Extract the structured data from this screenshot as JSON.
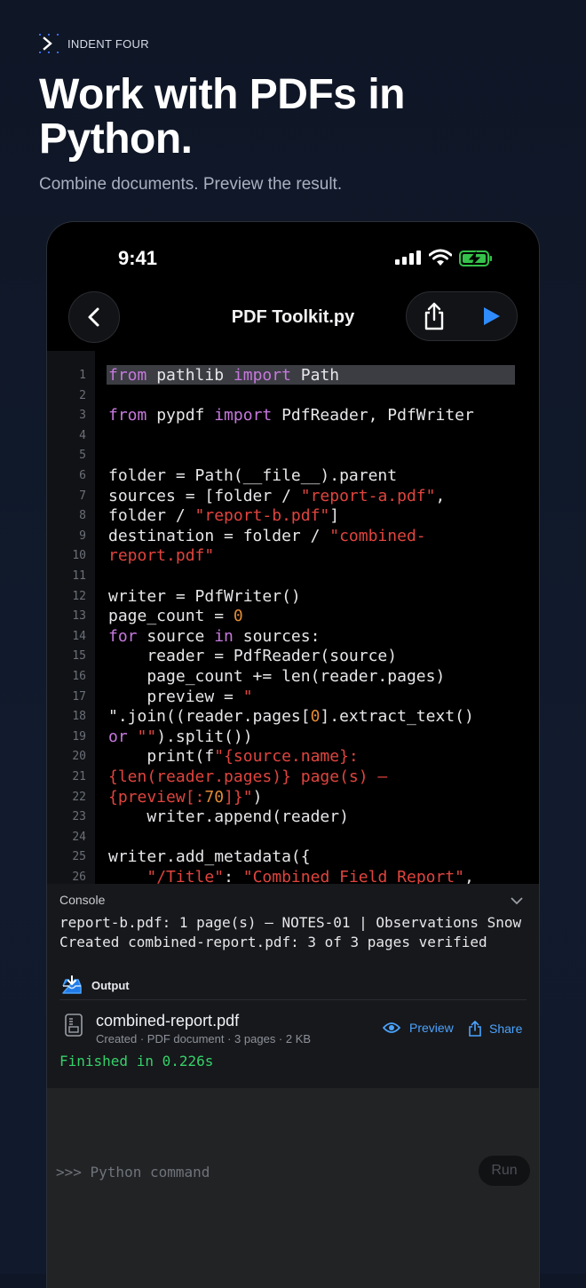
{
  "brand": {
    "name": "INDENT FOUR",
    "icon": "prompt-chevron-icon"
  },
  "headline": "Work with PDFs in Python.",
  "subhead": "Combine documents. Preview the result.",
  "status_bar": {
    "time": "9:41"
  },
  "toolbar": {
    "title": "PDF Toolkit.py"
  },
  "editor": {
    "line_numbers": [
      "1",
      "2",
      "3",
      "4",
      "5",
      "6",
      "7",
      "8",
      "9",
      "10",
      "11",
      "12",
      "13",
      "14",
      "15",
      "16",
      "17",
      "18",
      "19",
      "20",
      "21",
      "22",
      "23",
      "24",
      "25",
      "26"
    ],
    "lines": [
      [
        {
          "t": "from",
          "c": "kw"
        },
        {
          "t": " pathlib "
        },
        {
          "t": "import",
          "c": "kw"
        },
        {
          "t": " Path"
        }
      ],
      [],
      [
        {
          "t": "from",
          "c": "kw"
        },
        {
          "t": " pypdf "
        },
        {
          "t": "import",
          "c": "kw"
        },
        {
          "t": " PdfReader, PdfWriter"
        }
      ],
      [],
      [],
      [
        {
          "t": "folder = Path(__file__).parent"
        }
      ],
      [
        {
          "t": "sources = [folder / "
        },
        {
          "t": "\"report-a.pdf\"",
          "c": "st"
        },
        {
          "t": ","
        }
      ],
      [
        {
          "t": "folder / "
        },
        {
          "t": "\"report-b.pdf\"",
          "c": "st"
        },
        {
          "t": "]"
        }
      ],
      [
        {
          "t": "destination = folder / "
        },
        {
          "t": "\"combined-",
          "c": "st"
        }
      ],
      [
        {
          "t": "report.pdf\"",
          "c": "st"
        }
      ],
      [],
      [
        {
          "t": "writer = PdfWriter()"
        }
      ],
      [
        {
          "t": "page_count = "
        },
        {
          "t": "0",
          "c": "nm"
        }
      ],
      [
        {
          "t": "for",
          "c": "kw"
        },
        {
          "t": " source "
        },
        {
          "t": "in",
          "c": "kw"
        },
        {
          "t": " sources:"
        }
      ],
      [
        {
          "t": "    reader = PdfReader(source)"
        }
      ],
      [
        {
          "t": "    page_count += len(reader.pages)"
        }
      ],
      [
        {
          "t": "    preview = "
        },
        {
          "t": "\"",
          "c": "st"
        }
      ],
      [
        {
          "t": "\".join((reader.pages["
        },
        {
          "t": "0",
          "c": "nm"
        },
        {
          "t": "].extract_text()"
        }
      ],
      [
        {
          "t": "or",
          "c": "kw"
        },
        {
          "t": " "
        },
        {
          "t": "\"\"",
          "c": "st"
        },
        {
          "t": ").split())"
        }
      ],
      [
        {
          "t": "    print(f"
        },
        {
          "t": "\"{source.name}:",
          "c": "st"
        }
      ],
      [
        {
          "t": "{len(reader.pages)} page(s) —",
          "c": "st"
        }
      ],
      [
        {
          "t": "{preview[:",
          "c": "st"
        },
        {
          "t": "70",
          "c": "nm"
        },
        {
          "t": "]}\"",
          "c": "st"
        },
        {
          "t": ")"
        }
      ],
      [
        {
          "t": "    writer.append(reader)"
        }
      ],
      [],
      [
        {
          "t": "writer.add_metadata({"
        }
      ],
      [
        {
          "t": "    "
        },
        {
          "t": "\"/Title\"",
          "c": "st"
        },
        {
          "t": ": "
        },
        {
          "t": "\"Combined Field Report\"",
          "c": "st"
        },
        {
          "t": ","
        }
      ]
    ]
  },
  "console": {
    "label": "Console",
    "log_lines": [
      "report-b.pdf: 1 page(s) — NOTES-01 | Observations Snow",
      "Created combined-report.pdf: 3 of 3 pages verified"
    ],
    "output_label": "Output",
    "file_name": "combined-report.pdf",
    "file_meta": "Created · PDF document · 3 pages · 2 KB",
    "preview_label": "Preview",
    "share_label": "Share",
    "finished": "Finished in 0.226s"
  },
  "command": {
    "placeholder": ">>> Python command",
    "run_label": "Run"
  },
  "colors": {
    "keyword": "#c678dd",
    "string": "#e0443e",
    "number": "#e28b35",
    "accent": "#4aa3ff",
    "success": "#35d16a"
  }
}
